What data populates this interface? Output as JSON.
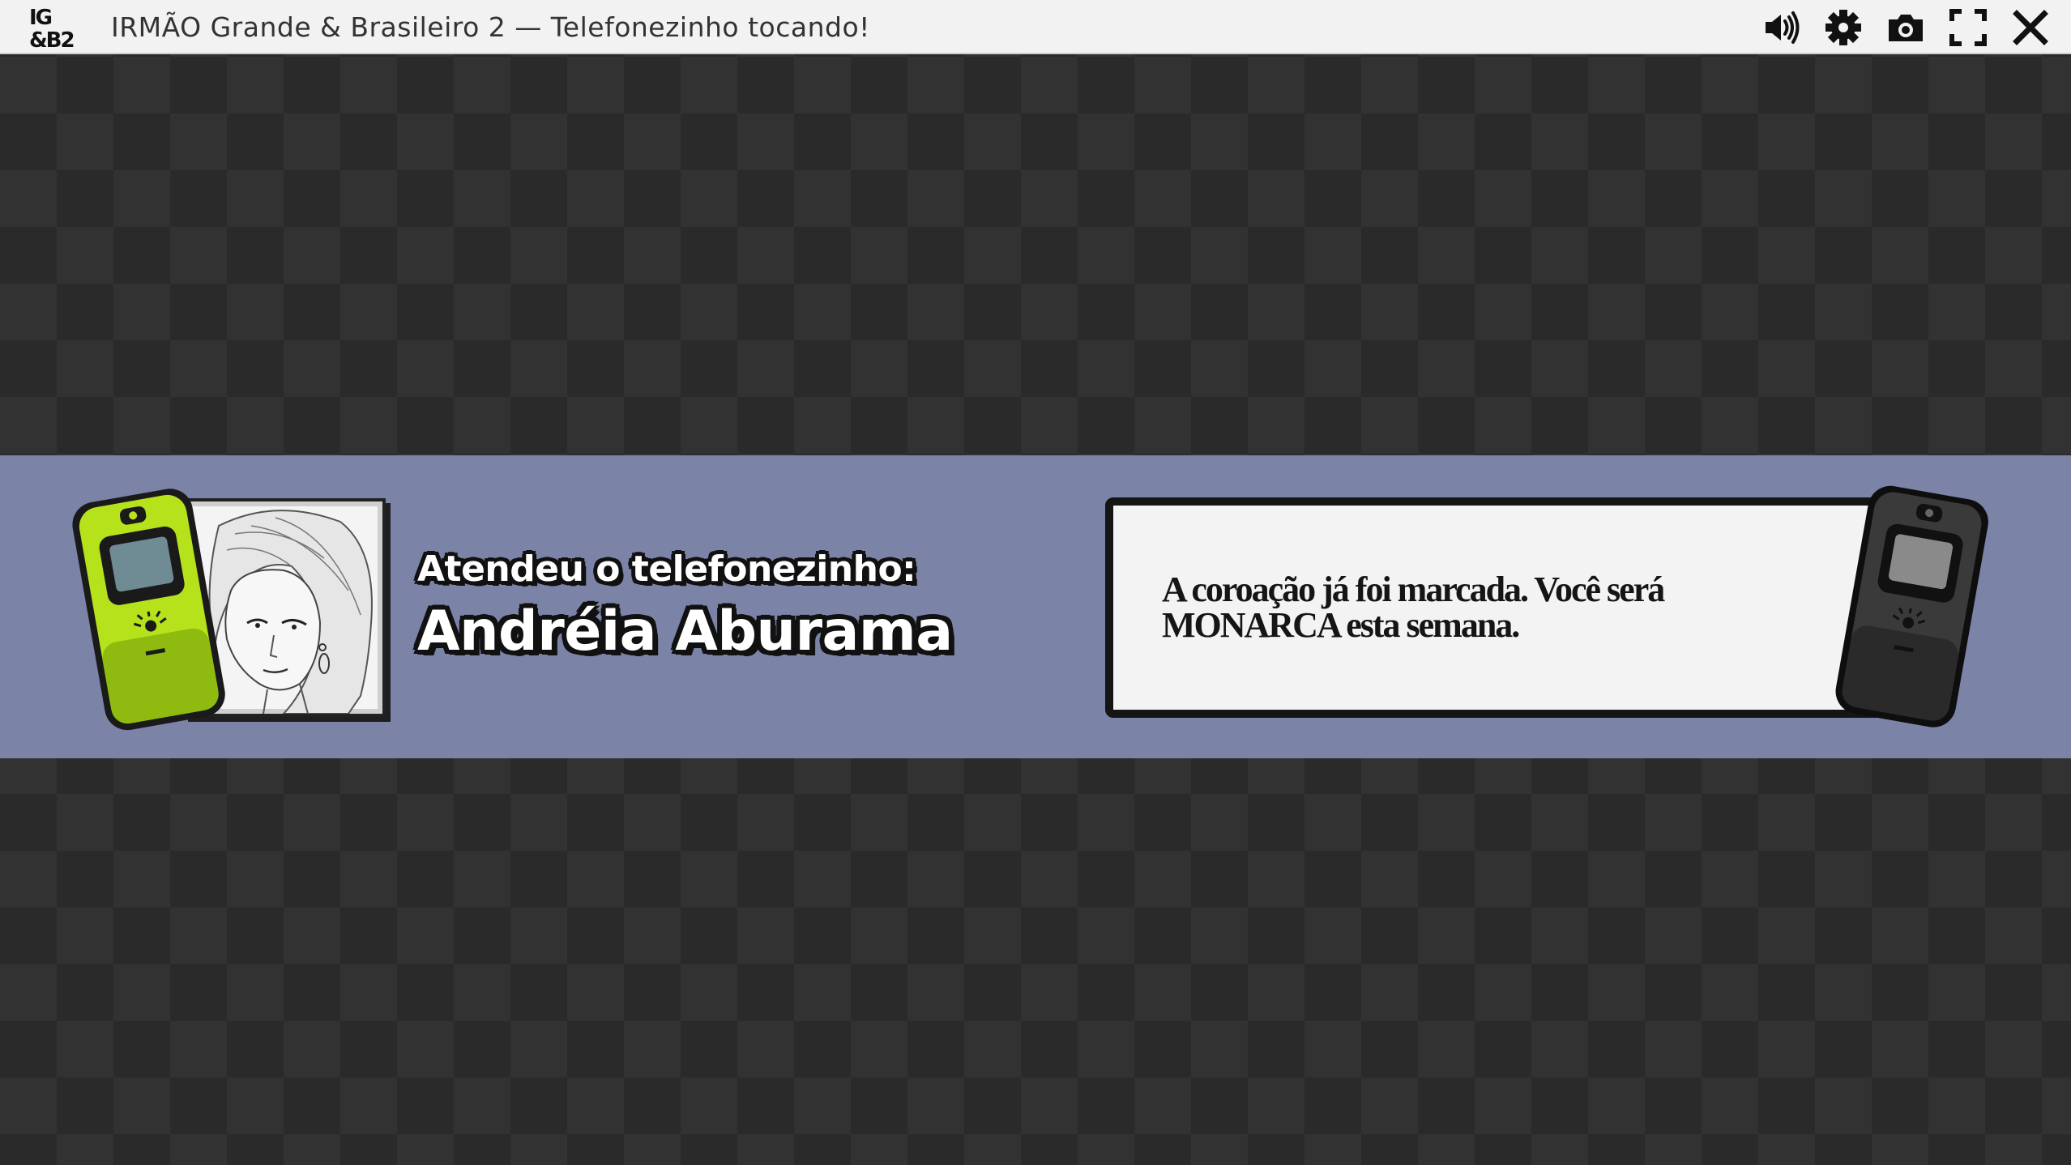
{
  "window": {
    "logo_text": "IG&B2",
    "title": "IRMÃO Grande & Brasileiro 2 — Telefonezinho tocando!",
    "controls": [
      {
        "name": "volume-icon"
      },
      {
        "name": "settings-gear-icon"
      },
      {
        "name": "screenshot-camera-icon"
      },
      {
        "name": "fullscreen-icon"
      },
      {
        "name": "close-icon"
      }
    ]
  },
  "call": {
    "label": "Atendeu o telefonezinho:",
    "caller_name": "Andréia Aburama",
    "message": "A coroação já foi marcada. Você será MONARCA esta semana.",
    "left_phone_color": "#b6e21c",
    "right_phone_color": "#3a3a3a",
    "banner_color": "#7b83a7"
  }
}
